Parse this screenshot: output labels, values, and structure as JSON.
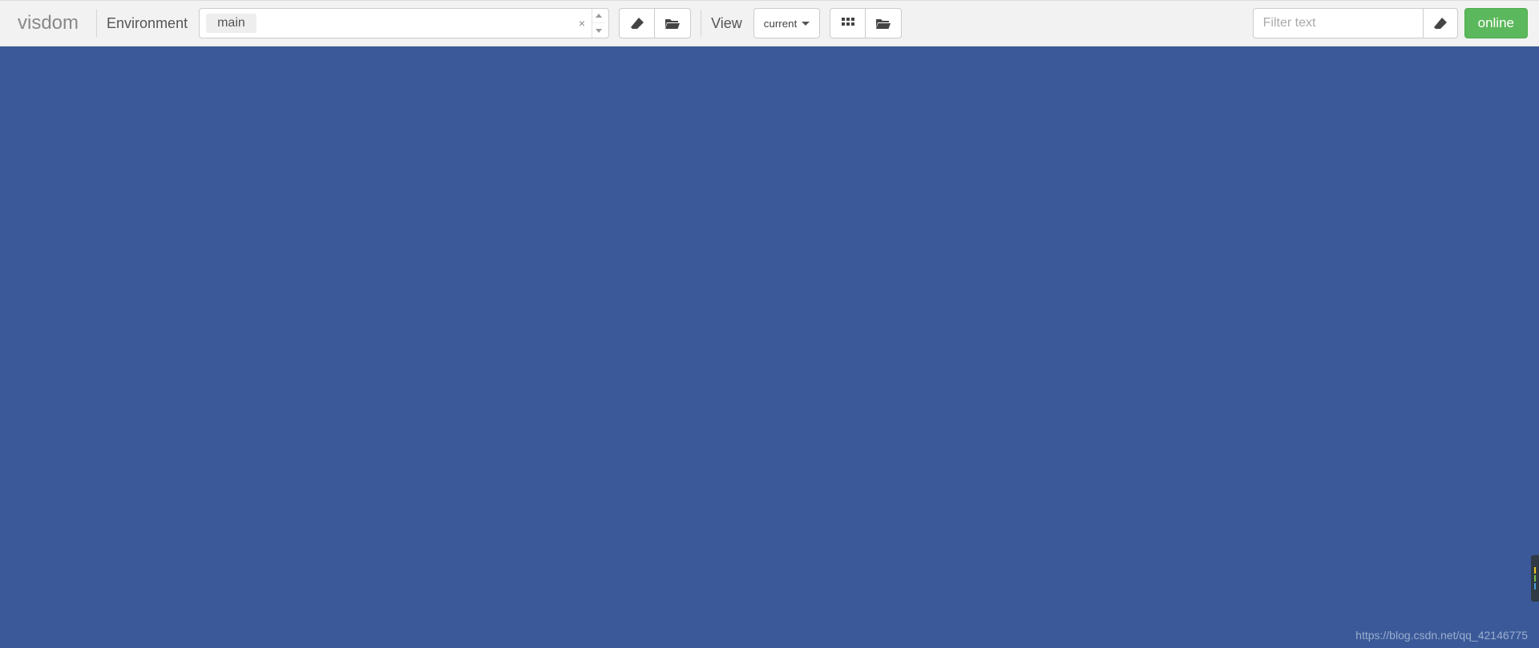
{
  "brand": "visdom",
  "environment": {
    "label": "Environment",
    "selected_tag": "main",
    "clear_symbol": "×"
  },
  "view": {
    "label": "View",
    "selected": "current"
  },
  "filter": {
    "placeholder": "Filter text"
  },
  "status": {
    "label": "online",
    "color": "#5cb85c"
  },
  "watermark": "https://blog.csdn.net/qq_42146775",
  "icons": {
    "eraser": "eraser-icon",
    "folder": "folder-open-icon",
    "grid": "grid-icon",
    "caret_up": "caret-up-icon",
    "caret_down": "caret-down-icon"
  }
}
